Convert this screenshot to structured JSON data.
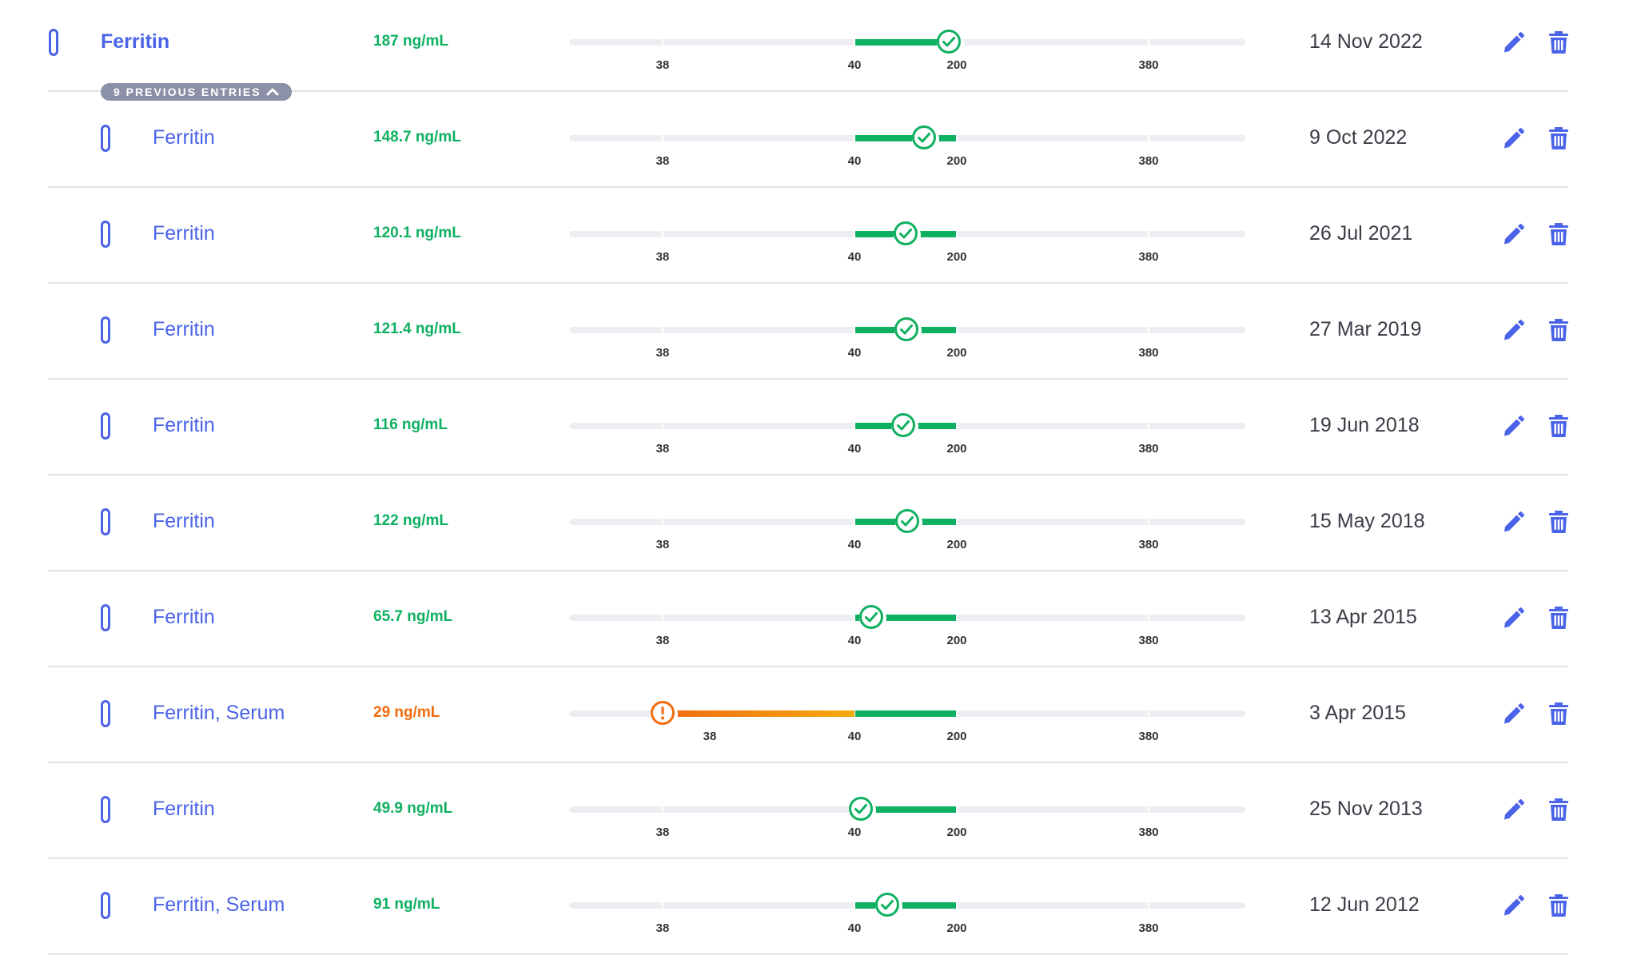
{
  "colors": {
    "link": "#4a63e8",
    "in_range": "#0fb061",
    "out_of_range": "#f26b0f",
    "track": "#edeef2",
    "divider": "#e3e4ea",
    "badge": "#8c91a8"
  },
  "range_ticks": [
    "38",
    "40",
    "200",
    "380"
  ],
  "collapse_control": {
    "label": "9 PREVIOUS ENTRIES",
    "icon": "chevron-up-icon"
  },
  "action_icons": {
    "edit": "pencil-icon",
    "delete": "trash-icon"
  },
  "entries": [
    {
      "name": "Ferritin",
      "value": "187 ng/mL",
      "value_num": 187,
      "status": "normal",
      "date": "14 Nov 2022"
    },
    {
      "name": "Ferritin",
      "value": "148.7 ng/mL",
      "value_num": 148.7,
      "status": "normal",
      "date": "9 Oct 2022"
    },
    {
      "name": "Ferritin",
      "value": "120.1 ng/mL",
      "value_num": 120.1,
      "status": "normal",
      "date": "26 Jul 2021"
    },
    {
      "name": "Ferritin",
      "value": "121.4 ng/mL",
      "value_num": 121.4,
      "status": "normal",
      "date": "27 Mar 2019"
    },
    {
      "name": "Ferritin",
      "value": "116 ng/mL",
      "value_num": 116,
      "status": "normal",
      "date": "19 Jun 2018"
    },
    {
      "name": "Ferritin",
      "value": "122 ng/mL",
      "value_num": 122,
      "status": "normal",
      "date": "15 May 2018"
    },
    {
      "name": "Ferritin",
      "value": "65.7 ng/mL",
      "value_num": 65.7,
      "status": "normal",
      "date": "13 Apr 2015"
    },
    {
      "name": "Ferritin, Serum",
      "value": "29 ng/mL",
      "value_num": 29,
      "status": "low",
      "date": "3 Apr 2015"
    },
    {
      "name": "Ferritin",
      "value": "49.9 ng/mL",
      "value_num": 49.9,
      "status": "normal",
      "date": "25 Nov 2013"
    },
    {
      "name": "Ferritin, Serum",
      "value": "91 ng/mL",
      "value_num": 91,
      "status": "normal",
      "date": "12 Jun 2012"
    }
  ]
}
